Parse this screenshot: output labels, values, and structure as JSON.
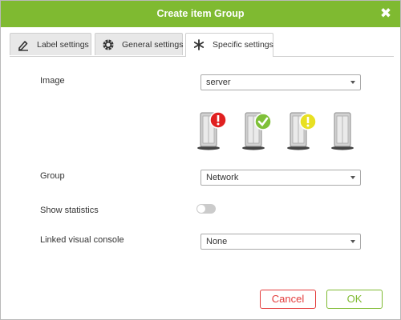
{
  "dialog": {
    "title": "Create item Group",
    "close_icon": "close-x-icon"
  },
  "colors": {
    "header": "#7fba31",
    "ok": "#7fba31",
    "cancel": "#e33c3c",
    "status_critical": "#e02020",
    "status_ok": "#7fc038",
    "status_warning": "#e8e022"
  },
  "tabs": [
    {
      "label": "Label settings",
      "icon": "pencil-icon",
      "active": false
    },
    {
      "label": "General settings",
      "icon": "gear-icon",
      "active": false
    },
    {
      "label": "Specific settings",
      "icon": "asterisk-icon",
      "active": true
    }
  ],
  "form": {
    "image": {
      "label": "Image",
      "value": "server"
    },
    "preview_icons": [
      "server-critical-icon",
      "server-ok-icon",
      "server-warning-icon",
      "server-default-icon"
    ],
    "group": {
      "label": "Group",
      "value": "Network"
    },
    "show_statistics": {
      "label": "Show statistics",
      "enabled": false
    },
    "linked_console": {
      "label": "Linked visual console",
      "value": "None"
    }
  },
  "buttons": {
    "cancel": "Cancel",
    "ok": "OK"
  }
}
